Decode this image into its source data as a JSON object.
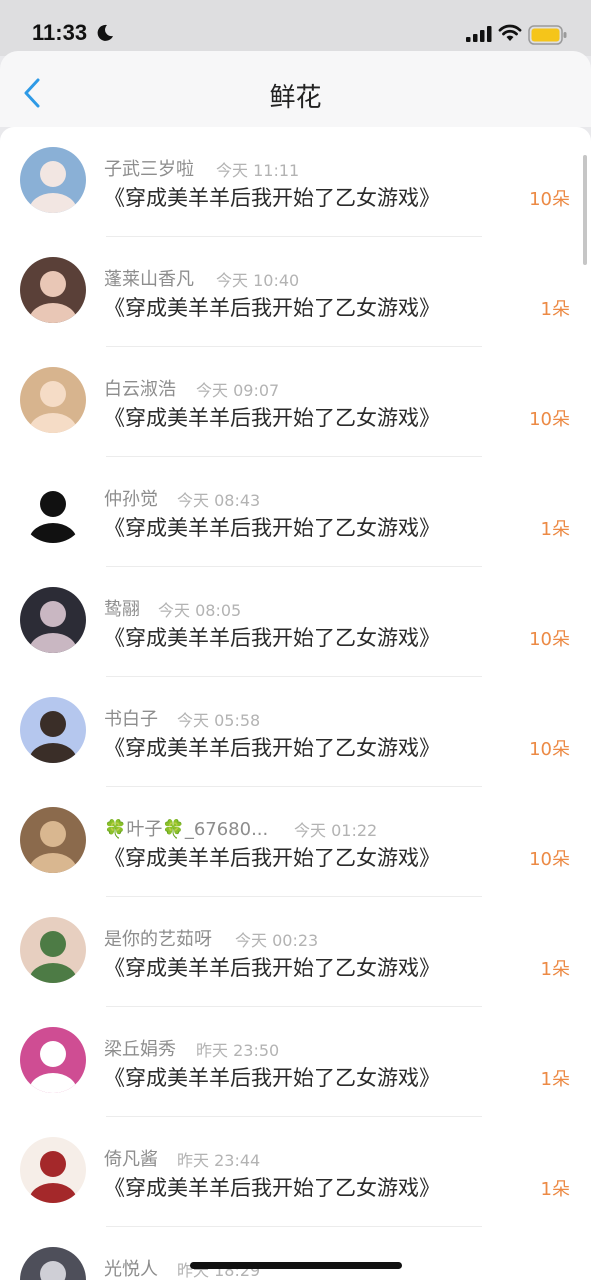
{
  "status_bar": {
    "time": "11:33"
  },
  "header": {
    "title": "鲜花"
  },
  "list": [
    {
      "name": "子武三岁啦",
      "time": "今天 11:11",
      "book": "《穿成美羊羊后我开始了乙女游戏》",
      "count": "10朵"
    },
    {
      "name": "蓬莱山香凡",
      "time": "今天 10:40",
      "book": "《穿成美羊羊后我开始了乙女游戏》",
      "count": "1朵"
    },
    {
      "name": "白云淑浩",
      "time": "今天 09:07",
      "book": "《穿成美羊羊后我开始了乙女游戏》",
      "count": "10朵"
    },
    {
      "name": "仲孙觉",
      "time": "今天 08:43",
      "book": "《穿成美羊羊后我开始了乙女游戏》",
      "count": "1朵"
    },
    {
      "name": "鸷翮",
      "time": "今天 08:05",
      "book": "《穿成美羊羊后我开始了乙女游戏》",
      "count": "10朵"
    },
    {
      "name": "书白子",
      "time": "今天 05:58",
      "book": "《穿成美羊羊后我开始了乙女游戏》",
      "count": "10朵"
    },
    {
      "name": "🍀叶子🍀_67680...",
      "time": "今天 01:22",
      "book": "《穿成美羊羊后我开始了乙女游戏》",
      "count": "10朵"
    },
    {
      "name": "是你的艺茹呀",
      "time": "今天 00:23",
      "book": "《穿成美羊羊后我开始了乙女游戏》",
      "count": "1朵"
    },
    {
      "name": "梁丘娟秀",
      "time": "昨天 23:50",
      "book": "《穿成美羊羊后我开始了乙女游戏》",
      "count": "1朵"
    },
    {
      "name": "倚凡酱",
      "time": "昨天 23:44",
      "book": "《穿成美羊羊后我开始了乙女游戏》",
      "count": "1朵"
    },
    {
      "name": "光悦人",
      "time": "昨天 18:29",
      "book": "",
      "count": ""
    }
  ],
  "avatars": [
    {
      "bg": "#8ab0d6",
      "fg": "#f2e6e2"
    },
    {
      "bg": "#5a4038",
      "fg": "#e9c7b6"
    },
    {
      "bg": "#d7b48e",
      "fg": "#f5dcc6"
    },
    {
      "bg": "#ffffff",
      "fg": "#111111"
    },
    {
      "bg": "#2c2c36",
      "fg": "#c9b7c2"
    },
    {
      "bg": "#b5c7ee",
      "fg": "#3a2e28"
    },
    {
      "bg": "#8b6a4c",
      "fg": "#d9b790"
    },
    {
      "bg": "#e7cfc0",
      "fg": "#4d7b45"
    },
    {
      "bg": "#cf4d93",
      "fg": "#ffffff"
    },
    {
      "bg": "#f6eee8",
      "fg": "#a4282a"
    },
    {
      "bg": "#4e4f5a",
      "fg": "#cfcfd6"
    }
  ]
}
